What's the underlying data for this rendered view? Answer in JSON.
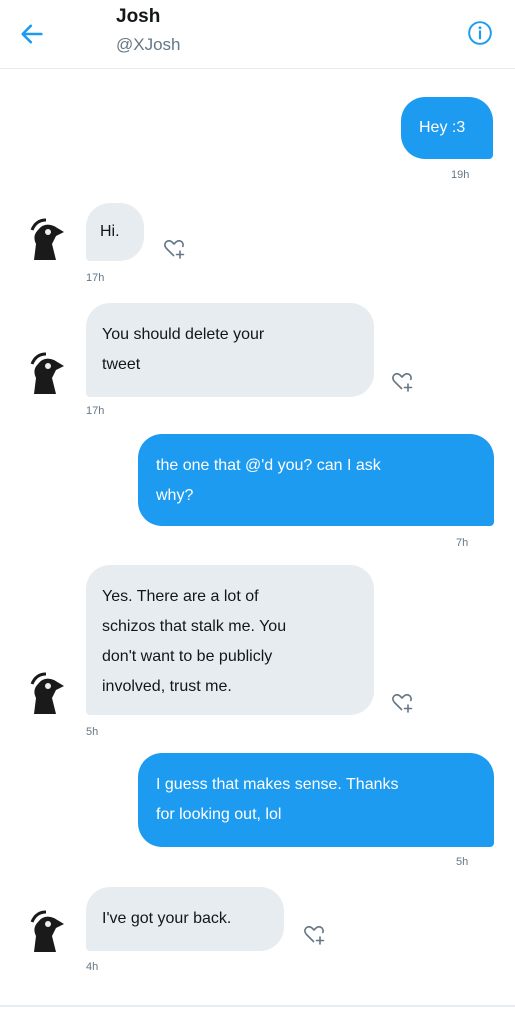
{
  "header": {
    "name": "Josh",
    "handle": "@XJosh"
  },
  "messages": [
    {
      "direction": "sent",
      "text": "Hey :3",
      "time": "19h"
    },
    {
      "direction": "received",
      "text": "Hi.",
      "time": "17h"
    },
    {
      "direction": "received",
      "lines": [
        "You should delete your",
        "tweet"
      ],
      "time": "17h"
    },
    {
      "direction": "sent",
      "lines": [
        "the one that @'d you? can I ask",
        "why?"
      ],
      "time": "7h"
    },
    {
      "direction": "received",
      "lines": [
        "Yes. There are a lot of",
        "schizos that stalk me. You",
        "don't want to be publicly",
        "involved, trust me."
      ],
      "time": "5h"
    },
    {
      "direction": "sent",
      "lines": [
        "I guess that makes sense. Thanks",
        "for looking out, lol"
      ],
      "time": "5h"
    },
    {
      "direction": "received",
      "text": "I've got your back.",
      "time": "4h"
    }
  ],
  "colors": {
    "accent": "#1d9bf0",
    "incoming_bubble": "#e6ecf0"
  },
  "icons": {
    "back": "arrow-left-icon",
    "info": "info-circle-icon",
    "like": "heart-plus-icon"
  }
}
